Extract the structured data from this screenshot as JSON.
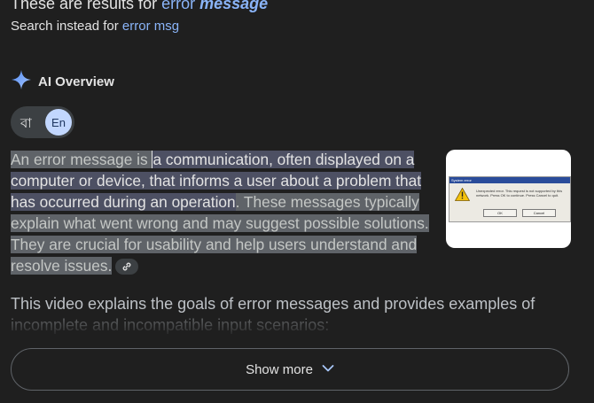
{
  "spelling": {
    "results_prefix": "These are results for",
    "query_plain": "error",
    "query_bold": "message",
    "search_instead_prefix": "Search instead for",
    "original_query": "error msg"
  },
  "ai_overview": {
    "title": "AI Overview",
    "icon": "sparkle-icon",
    "accent": "#8ab4f8"
  },
  "language_toggle": {
    "bengali": "বা",
    "english": "En",
    "selected": "English"
  },
  "paragraph": {
    "part1": "An error message is ",
    "part2": "a communication, often displayed on a computer or device, that informs a user about a problem that has occurred during an operation",
    "part3": ". These messages typically explain what went wrong and may suggest possible solutions. They are crucial for usability and help users understand and resolve issues.",
    "link_icon": "link-icon"
  },
  "thumbnail": {
    "title": "System error",
    "message": "Unexpected error. This request is not supported by this network. Press OK to continue. Press Cancel to quit.",
    "ok": "OK",
    "cancel": "Cancel",
    "icon": "warning-icon"
  },
  "video_text": {
    "line1": "This video explains the goals of error messages and provides examples of",
    "line2": "incomplete and incompatible input scenarios:"
  },
  "show_more": {
    "label": "Show more",
    "icon": "chevron-down-icon"
  }
}
